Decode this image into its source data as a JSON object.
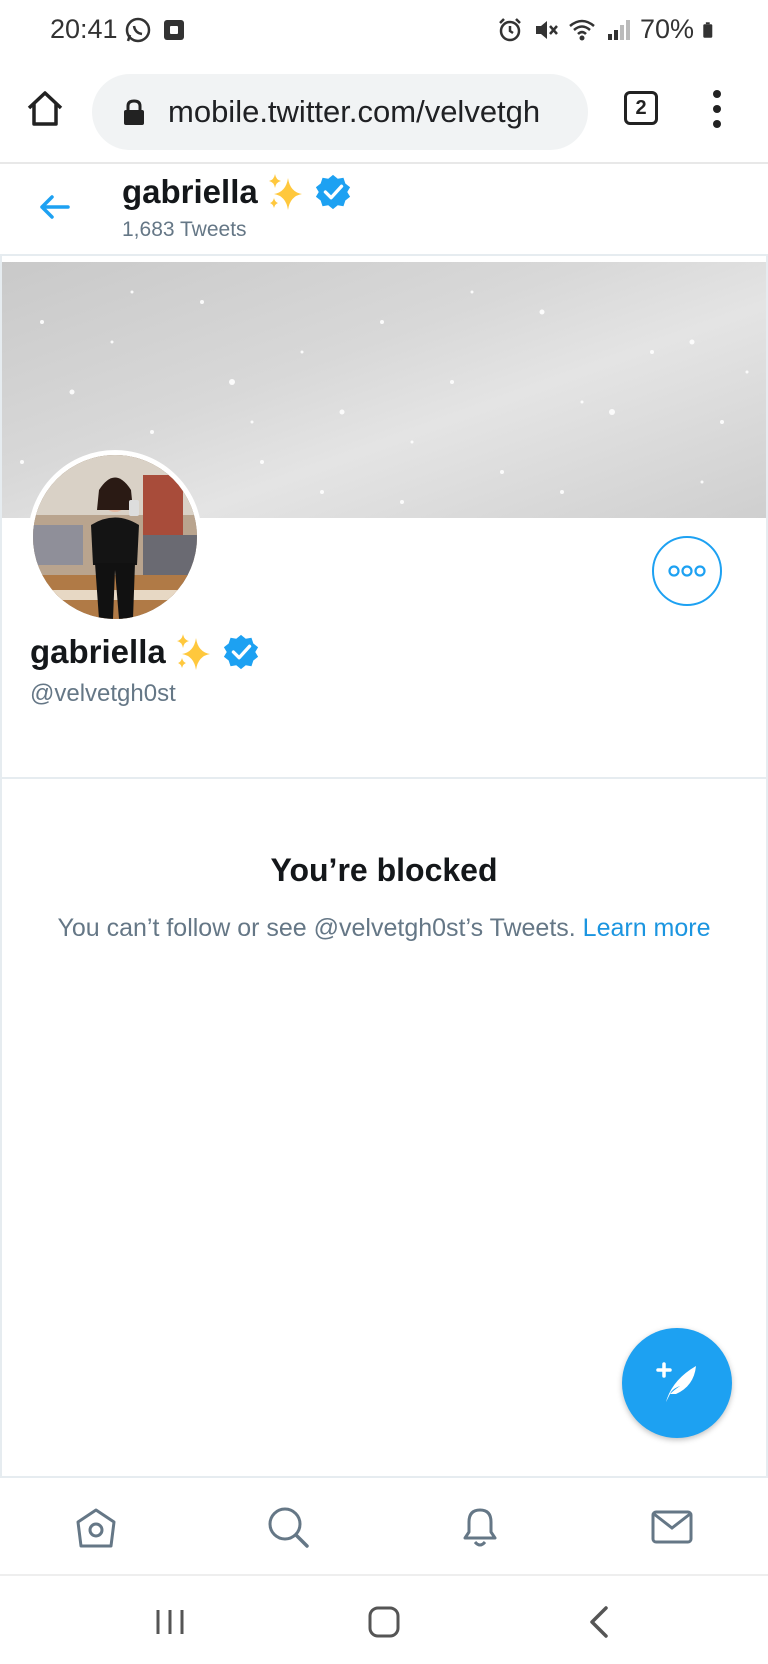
{
  "status_bar": {
    "time": "20:41",
    "battery": "70%",
    "left_icons": [
      "whatsapp-icon",
      "app-notification-icon"
    ],
    "right_icons": [
      "alarm-icon",
      "mute-icon",
      "wifi-icon",
      "signal-icon",
      "battery-icon"
    ]
  },
  "browser": {
    "url": "mobile.twitter.com/velvetgh",
    "tab_count": "2"
  },
  "header": {
    "name": "gabriella",
    "tweet_count": "1,683 Tweets"
  },
  "profile": {
    "name": "gabriella",
    "handle": "@velvetgh0st"
  },
  "blocked": {
    "title": "You’re blocked",
    "message": "You can’t follow or see @velvetgh0st’s Tweets.",
    "link": "Learn more"
  },
  "tab_bar": {
    "items": [
      "home-icon",
      "search-icon",
      "notifications-icon",
      "messages-icon"
    ]
  },
  "nav_bar": {
    "items": [
      "recents-icon",
      "home-nav-icon",
      "back-nav-icon"
    ]
  },
  "colors": {
    "accent": "#1da1f2",
    "link": "#1b95e0",
    "secondary_text": "#657786",
    "sparkle": "#ffc83d"
  }
}
